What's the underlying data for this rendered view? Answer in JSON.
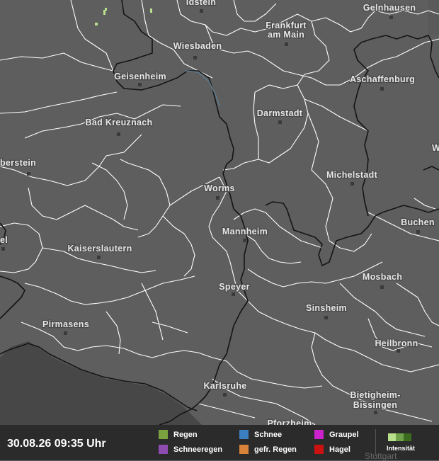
{
  "map": {
    "cities": [
      {
        "id": "idstein",
        "name": "Idstein"
      },
      {
        "id": "gelnhausen",
        "name": "Gelnhausen"
      },
      {
        "id": "frankfurt_1",
        "name": "Frankfurt"
      },
      {
        "id": "frankfurt_2",
        "name": "am Main"
      },
      {
        "id": "wiesbaden",
        "name": "Wiesbaden"
      },
      {
        "id": "geisenheim",
        "name": "Geisenheim"
      },
      {
        "id": "aschaffenburg",
        "name": "Aschaffenburg"
      },
      {
        "id": "darmstadt",
        "name": "Darmstadt"
      },
      {
        "id": "badkreuznach",
        "name": "Bad Kreuznach"
      },
      {
        "id": "berstein",
        "name": "berstein"
      },
      {
        "id": "michelstadt",
        "name": "Michelstadt"
      },
      {
        "id": "worms",
        "name": "Worms"
      },
      {
        "id": "buchen",
        "name": "Buchen"
      },
      {
        "id": "mannheim",
        "name": "Mannheim"
      },
      {
        "id": "el",
        "name": "el"
      },
      {
        "id": "kaiserslautern",
        "name": "Kaiserslautern"
      },
      {
        "id": "mosbach",
        "name": "Mosbach"
      },
      {
        "id": "speyer",
        "name": "Speyer"
      },
      {
        "id": "sinsheim",
        "name": "Sinsheim"
      },
      {
        "id": "pirmasens",
        "name": "Pirmasens"
      },
      {
        "id": "heilbronn",
        "name": "Heilbronn"
      },
      {
        "id": "karlsruhe",
        "name": "Karlsruhe"
      },
      {
        "id": "bietigheim_1",
        "name": "Bietigheim-"
      },
      {
        "id": "bietigheim_2",
        "name": "Bissingen"
      },
      {
        "id": "pforzheim",
        "name": "Pforzheim"
      },
      {
        "id": "w",
        "name": "W"
      }
    ]
  },
  "footer": {
    "timestamp": "30.08.26 09:35 Uhr",
    "legend": [
      {
        "label": "Regen",
        "color": "#7aa23e"
      },
      {
        "label": "Schneeregen",
        "color": "#8e4bb0"
      },
      {
        "label": "Schnee",
        "color": "#3b7fc0"
      },
      {
        "label": "gefr. Regen",
        "color": "#d9823a"
      },
      {
        "label": "Graupel",
        "color": "#cc22cc"
      },
      {
        "label": "Hagel",
        "color": "#cc1111"
      }
    ],
    "intensity_label": "Intensität",
    "intensity_colors": [
      "#b9e08a",
      "#6ea34a",
      "#3a6b1e"
    ],
    "watermark": "Stuttgart"
  }
}
